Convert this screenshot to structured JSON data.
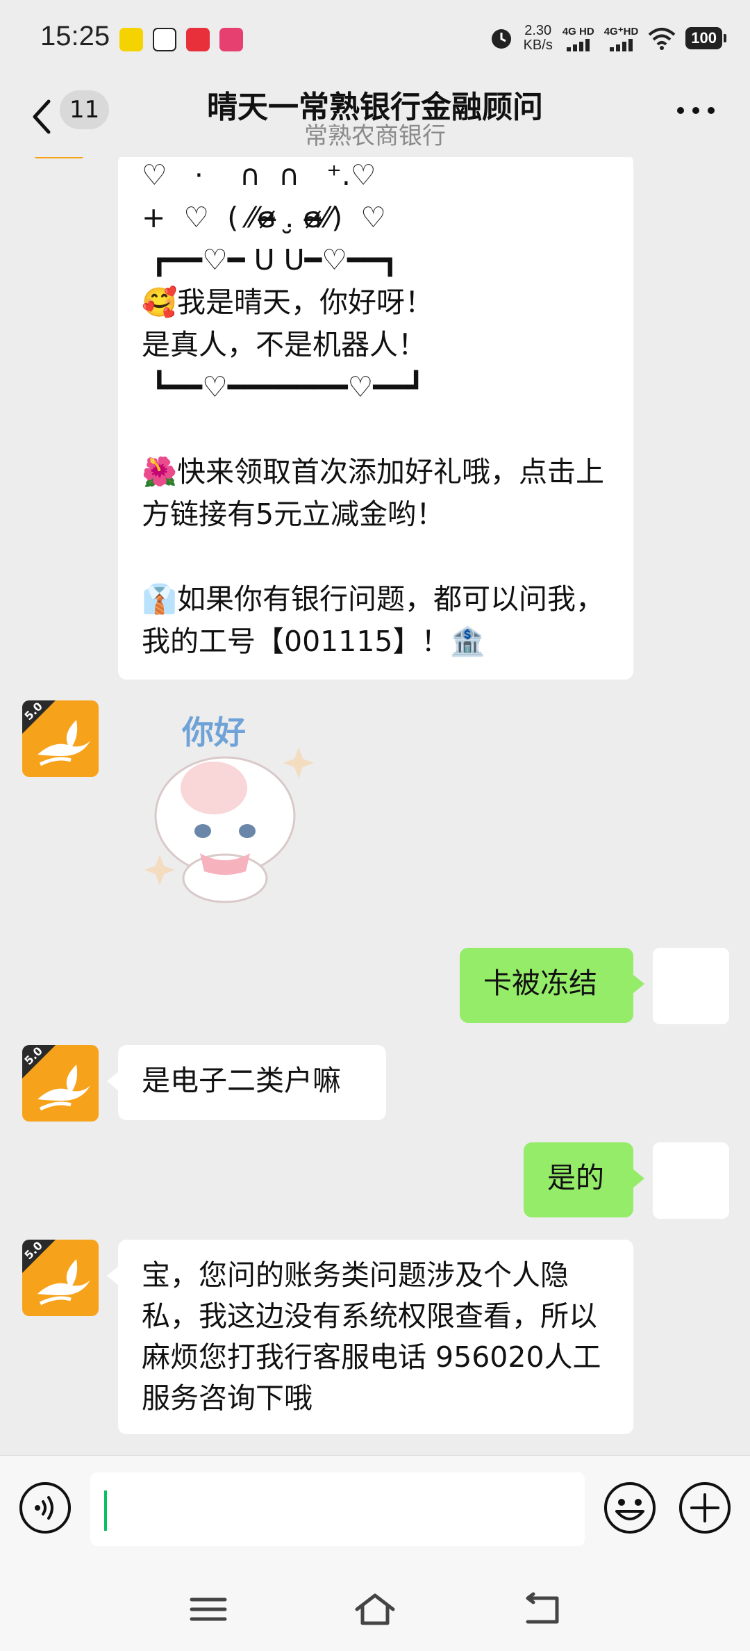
{
  "status_bar": {
    "time": "15:25",
    "net_speed_value": "2.30",
    "net_speed_unit": "KB/s",
    "signal1": "4G HD",
    "signal2": "4G⁺HD",
    "battery": "100"
  },
  "header": {
    "unread_count": "11",
    "title": "晴天一常熟银行金融顾问",
    "subtitle": "常熟农商银行"
  },
  "messages": {
    "intro": "♡   ·    ∩  ∩   ⁺.♡\n+  ♡  ( ⁄⁄ɞ̴̶̷ .̮ ɞ̴̶̷⁄⁄)  ♡\n ┏━━♡━ U U━♡━━┓\n🥰我是晴天，你好呀！\n是真人，不是机器人！\n ┗━━♡━━━━━━━♡━━┛\n\n🌺快来领取首次添加好礼哦，点击上方链接有5元立减金哟！\n\n👔如果你有银行问题，都可以问我，我的工号【001115】！🏦",
    "sticker_text": "你好",
    "avatar_badge": "5.0",
    "out_frozen": "卡被冻结",
    "in_question": "是电子二类户嘛",
    "out_yes": "是的",
    "in_reply": "宝，您问的账务类问题涉及个人隐私，我这边没有系统权限查看，所以麻烦您打我行客服电话 956020人工服务咨询下哦"
  },
  "input": {
    "value": "",
    "placeholder": ""
  },
  "colors": {
    "background": "#ededed",
    "bubble_out": "#95ec69",
    "bubble_in": "#ffffff",
    "accent": "#07c160",
    "avatar_orange": "#f7a21b"
  },
  "icons": [
    "back-icon",
    "more-icon",
    "voice-icon",
    "emoji-icon",
    "plus-icon",
    "menu-icon",
    "home-icon",
    "back-nav-icon"
  ]
}
